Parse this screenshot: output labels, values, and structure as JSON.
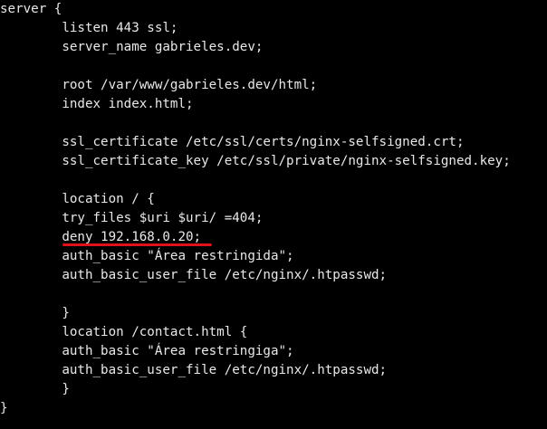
{
  "config_lines": [
    "server {",
    "        listen 443 ssl;",
    "        server_name gabrieles.dev;",
    "",
    "        root /var/www/gabrieles.dev/html;",
    "        index index.html;",
    "",
    "        ssl_certificate /etc/ssl/certs/nginx-selfsigned.crt;",
    "        ssl_certificate_key /etc/ssl/private/nginx-selfsigned.key;",
    "",
    "        location / {",
    "        try_files $uri $uri/ =404;",
    "        deny 192.168.0.20;",
    "        auth_basic \"Área restringida\";",
    "        auth_basic_user_file /etc/nginx/.htpasswd;",
    "",
    "        }",
    "        location /contact.html {",
    "        auth_basic \"Área restringiga\";",
    "        auth_basic_user_file /etc/nginx/.htpasswd;",
    "        }",
    "}"
  ],
  "highlight": {
    "line_index": 12,
    "color": "#e0111b"
  },
  "colors": {
    "background": "#000000",
    "text": "#e8e8e8"
  }
}
